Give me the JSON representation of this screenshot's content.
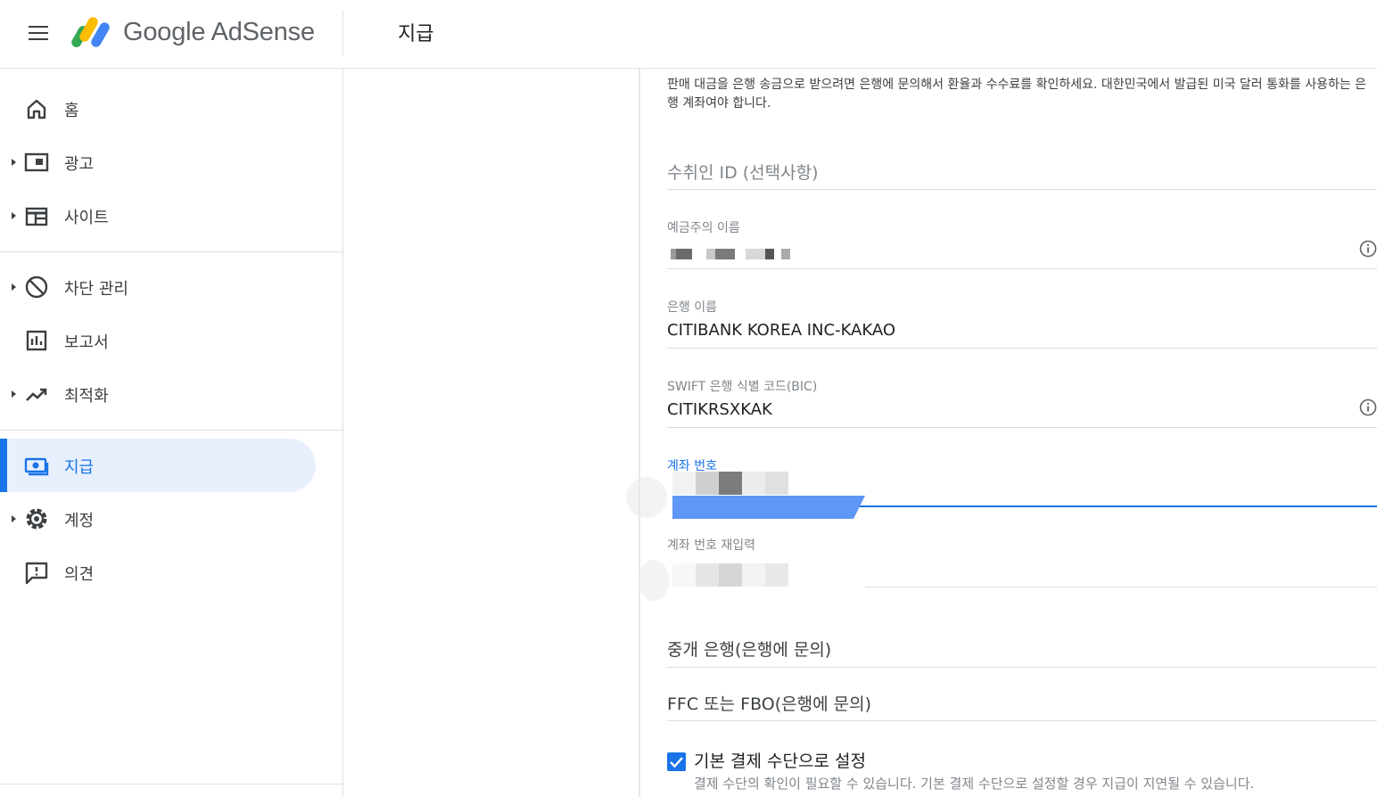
{
  "header": {
    "brand": "Google AdSense",
    "page_title": "지급"
  },
  "sidebar": {
    "items": [
      {
        "label": "홈",
        "icon": "home-icon",
        "expandable": false
      },
      {
        "label": "광고",
        "icon": "ads-icon",
        "expandable": true
      },
      {
        "label": "사이트",
        "icon": "sites-icon",
        "expandable": true
      },
      {
        "label": "차단 관리",
        "icon": "block-icon",
        "expandable": true
      },
      {
        "label": "보고서",
        "icon": "reports-icon",
        "expandable": false
      },
      {
        "label": "최적화",
        "icon": "optimization-icon",
        "expandable": true
      },
      {
        "label": "지급",
        "icon": "payments-icon",
        "expandable": false,
        "active": true
      },
      {
        "label": "계정",
        "icon": "gear-icon",
        "expandable": true
      },
      {
        "label": "의견",
        "icon": "feedback-icon",
        "expandable": false
      }
    ]
  },
  "form": {
    "intro": "판매 대금을 은행 송금으로 받으려면 은행에 문의해서 환율과 수수료를 확인하세요. 대한민국에서 발급된 미국 달러 통화를 사용하는 은행 계좌여야 합니다.",
    "beneficiary_id_placeholder": "수취인 ID (선택사항)",
    "account_holder_label": "예금주의 이름",
    "bank_name_label": "은행 이름",
    "bank_name_value": "CITIBANK KOREA INC-KAKAO",
    "swift_label": "SWIFT 은행 식별 코드(BIC)",
    "swift_value": "CITIKRSXKAK",
    "account_number_label": "계좌 번호",
    "account_number_confirm_label": "계좌 번호 재입력",
    "intermediary_bank_placeholder": "중개 은행(은행에 문의)",
    "ffc_placeholder": "FFC 또는 FBO(은행에 문의)",
    "default_payment_label": "기본 결제 수단으로 설정",
    "default_payment_checked": true,
    "default_payment_help": "결제 수단의 확인이 필요할 수 있습니다. 기본 결제 수단으로 설정할 경우 지급이 지연될 수 있습니다."
  },
  "colors": {
    "accent": "#1a73e8",
    "active_bg": "#e8f0fe",
    "divider": "#e0e0e0"
  }
}
